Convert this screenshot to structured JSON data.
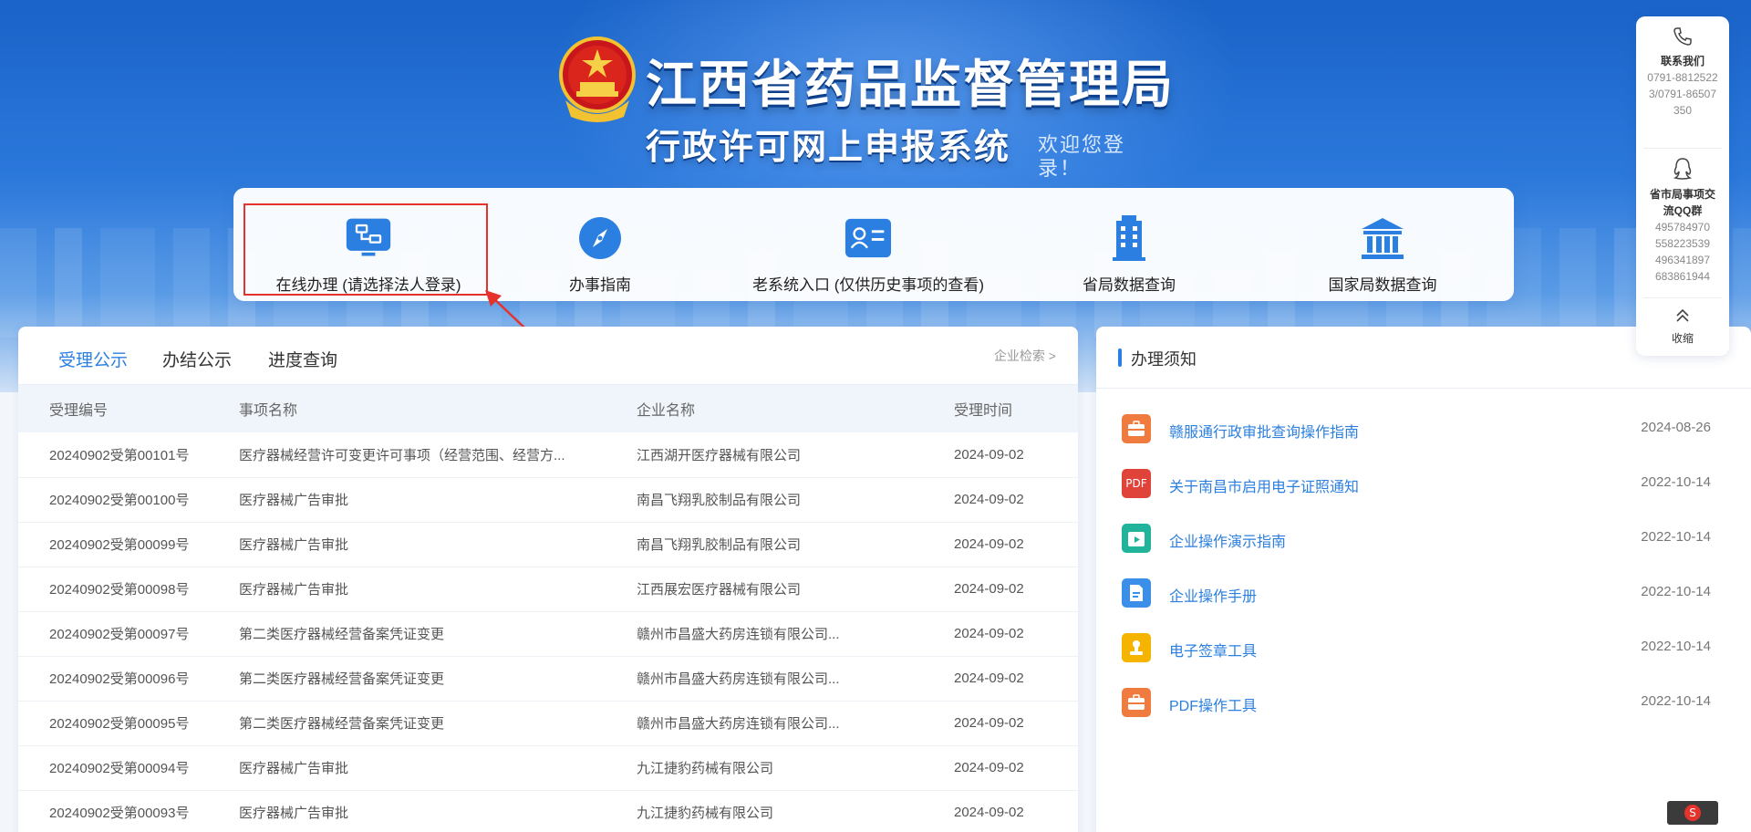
{
  "header": {
    "title": "江西省药品监督管理局",
    "subtitle": "行政许可网上申报系统",
    "welcome": "欢迎您登录！"
  },
  "quick": {
    "items": [
      {
        "label": "在线办理 (请选择法人登录)",
        "icon": "workflow-monitor-icon"
      },
      {
        "label": "办事指南",
        "icon": "compass-icon"
      },
      {
        "label": "老系统入口 (仅供历史事项的查看)",
        "icon": "id-card-icon"
      },
      {
        "label": "省局数据查询",
        "icon": "building-icon"
      },
      {
        "label": "国家局数据查询",
        "icon": "government-building-icon"
      }
    ]
  },
  "tabs": {
    "items": [
      "受理公示",
      "办结公示",
      "进度查询"
    ],
    "active": 0,
    "enterprise_search": "企业检索 >"
  },
  "table": {
    "headers": [
      "受理编号",
      "事项名称",
      "企业名称",
      "受理时间"
    ],
    "rows": [
      [
        "20240902受第00101号",
        "医疗器械经营许可变更许可事项（经营范围、经营方...",
        "江西湖开医疗器械有限公司",
        "2024-09-02"
      ],
      [
        "20240902受第00100号",
        "医疗器械广告审批",
        "南昌飞翔乳胶制品有限公司",
        "2024-09-02"
      ],
      [
        "20240902受第00099号",
        "医疗器械广告审批",
        "南昌飞翔乳胶制品有限公司",
        "2024-09-02"
      ],
      [
        "20240902受第00098号",
        "医疗器械广告审批",
        "江西展宏医疗器械有限公司",
        "2024-09-02"
      ],
      [
        "20240902受第00097号",
        "第二类医疗器械经营备案凭证变更",
        "赣州市昌盛大药房连锁有限公司...",
        "2024-09-02"
      ],
      [
        "20240902受第00096号",
        "第二类医疗器械经营备案凭证变更",
        "赣州市昌盛大药房连锁有限公司...",
        "2024-09-02"
      ],
      [
        "20240902受第00095号",
        "第二类医疗器械经营备案凭证变更",
        "赣州市昌盛大药房连锁有限公司...",
        "2024-09-02"
      ],
      [
        "20240902受第00094号",
        "医疗器械广告审批",
        "九江捷豹药械有限公司",
        "2024-09-02"
      ],
      [
        "20240902受第00093号",
        "医疗器械广告审批",
        "九江捷豹药械有限公司",
        "2024-09-02"
      ]
    ]
  },
  "notice": {
    "title": "办理须知",
    "items": [
      {
        "text": "赣服通行政审批查询操作指南",
        "date": "2024-08-26",
        "icon": "briefcase-icon",
        "color": "#f07b3f"
      },
      {
        "text": "关于南昌市启用电子证照通知",
        "date": "2022-10-14",
        "icon": "pdf-icon",
        "color": "#e0433a",
        "badge": "PDF"
      },
      {
        "text": "企业操作演示指南",
        "date": "2022-10-14",
        "icon": "video-calendar-icon",
        "color": "#22b39b"
      },
      {
        "text": "企业操作手册",
        "date": "2022-10-14",
        "icon": "document-icon",
        "color": "#3b8fe8"
      },
      {
        "text": "电子签章工具",
        "date": "2022-10-14",
        "icon": "stamp-icon",
        "color": "#f5b400"
      },
      {
        "text": "PDF操作工具",
        "date": "2022-10-14",
        "icon": "briefcase-icon",
        "color": "#f07b3f"
      }
    ]
  },
  "side": {
    "contact_label": "联系我们",
    "contact_value": "0791-88125223/0791-86507350",
    "qq_label": "省市局事项交流QQ群",
    "qq_values": [
      "495784970",
      "558223539",
      "496341897",
      "683861944"
    ],
    "collapse_label": "收缩"
  },
  "colors": {
    "accent": "#2b7fe0",
    "highlight": "#e5322d"
  }
}
